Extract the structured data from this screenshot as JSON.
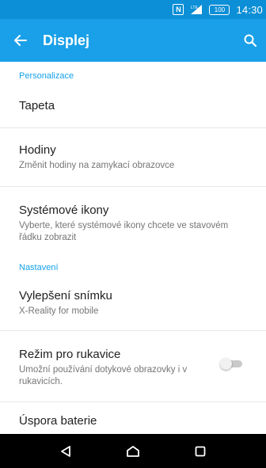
{
  "status_bar": {
    "nfc_label": "N",
    "signal_label": "LTE",
    "battery_label": "100",
    "time": "14:30"
  },
  "app_bar": {
    "title": "Displej",
    "back_icon": "arrow-left-icon",
    "search_icon": "search-icon"
  },
  "sections": [
    {
      "header": "Personalizace",
      "items": [
        {
          "title": "Tapeta",
          "subtitle": ""
        },
        {
          "title": "Hodiny",
          "subtitle": "Změnit hodiny na zamykací obrazovce"
        },
        {
          "title": "Systémové ikony",
          "subtitle": "Vyberte, které systémové ikony chcete ve stavovém řádku zobrazit"
        }
      ]
    },
    {
      "header": "Nastavení",
      "items": [
        {
          "title": "Vylepšení snímku",
          "subtitle": "X-Reality for mobile"
        },
        {
          "title": "Režim pro rukavice",
          "subtitle": "Umožní používání dotykové obrazovky i v rukavicích.",
          "toggle": false
        },
        {
          "title": "Úspora baterie",
          "subtitle": ""
        }
      ]
    }
  ],
  "nav_bar": {
    "back": "triangle-back-icon",
    "home": "home-icon",
    "recents": "recents-square-icon"
  },
  "colors": {
    "status_bar": "#0c8fd6",
    "app_bar": "#1aa0e8",
    "accent": "#14a1ea"
  }
}
